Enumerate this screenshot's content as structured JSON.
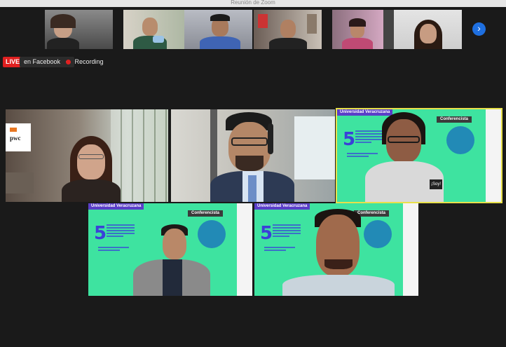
{
  "window": {
    "title": "Reunión de Zoom"
  },
  "stream": {
    "live_label": "LIVE",
    "destination_label": "en Facebook",
    "recording_label": "Recording"
  },
  "navigation": {
    "next_page_symbol": "›"
  },
  "slide": {
    "university": "Universidad Veracruzana",
    "role": "Conferencista",
    "number": "5"
  },
  "colors": {
    "accent": "#1e6fe0",
    "live": "#e02020",
    "slide_green": "#3ee3a0",
    "slide_purple": "#5a3ec8",
    "active_border": "#e8e04a"
  },
  "tiles": {
    "pwc_logo": "pwc",
    "shirt_text": "¡Soy!"
  }
}
